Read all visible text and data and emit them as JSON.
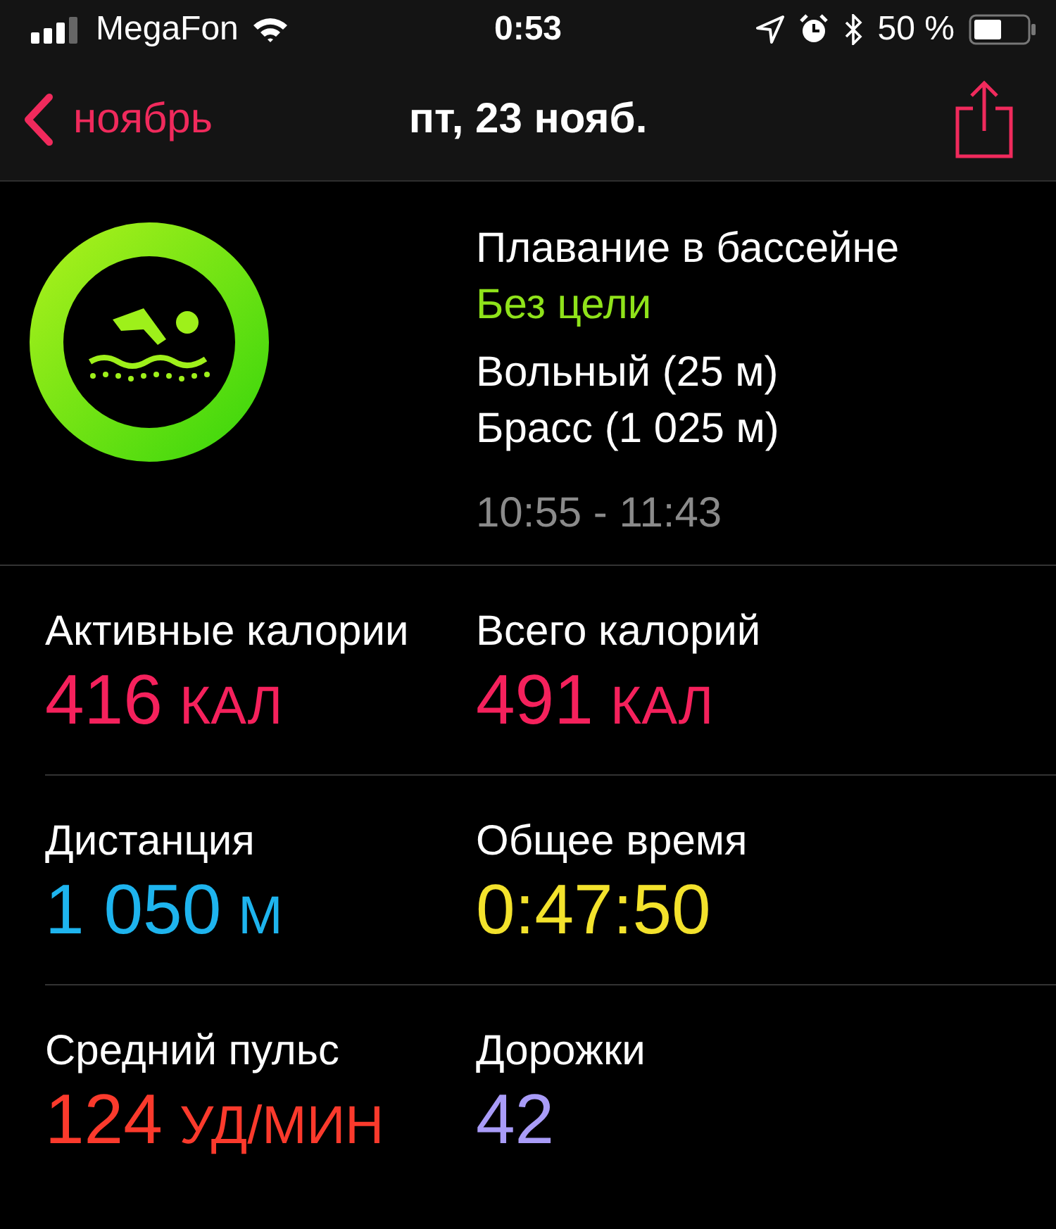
{
  "status_bar": {
    "carrier": "MegaFon",
    "time": "0:53",
    "battery": "50 %"
  },
  "nav": {
    "back": "ноябрь",
    "title": "пт, 23 нояб."
  },
  "workout": {
    "name": "Плавание в бассейне",
    "goal": "Без цели",
    "strokes": [
      "Вольный (25 м)",
      "Брасс (1 025 м)"
    ],
    "time_range": "10:55 - 11:43"
  },
  "metrics": [
    {
      "label": "Активные калории",
      "value": "416",
      "unit": "КАЛ",
      "color": "#f5215c"
    },
    {
      "label": "Всего калорий",
      "value": "491",
      "unit": "КАЛ",
      "color": "#f5215c"
    },
    {
      "label": "Дистанция",
      "value": "1 050",
      "unit": "М",
      "color": "#1eb4ee"
    },
    {
      "label": "Общее время",
      "value": "0:47:50",
      "color": "#f3e22c"
    },
    {
      "label": "Средний пульс",
      "value": "124",
      "unit": "УД/МИН",
      "color": "#fb3a2c"
    },
    {
      "label": "Дорожки",
      "value": "42",
      "color": "#a99cf8"
    }
  ]
}
